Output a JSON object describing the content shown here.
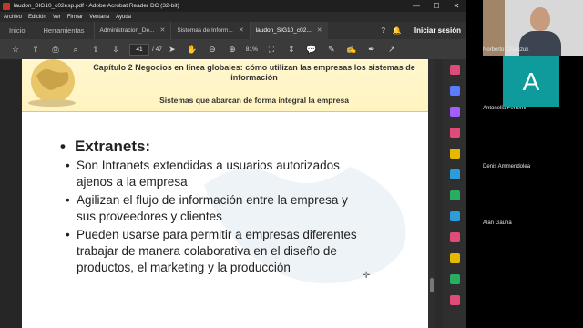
{
  "window": {
    "title": "laudon_SIG10_c02esp.pdf - Adobe Acrobat Reader DC (32-bit)",
    "controls": [
      "—",
      "☐",
      "✕"
    ]
  },
  "menu": [
    "Archivo",
    "Edición",
    "Ver",
    "Firmar",
    "Ventana",
    "Ayuda"
  ],
  "tabs": {
    "home": "Inicio",
    "tools": "Herramientas",
    "documents": [
      {
        "label": "Administracion_De..."
      },
      {
        "label": "Sistemas de Inform..."
      },
      {
        "label": "laudon_SIG10_c02..."
      }
    ],
    "signin": "Iniciar sesión"
  },
  "toolbar": {
    "page_current": "41",
    "page_total": "/ 47",
    "zoom": "81%"
  },
  "slide": {
    "chapter_title": "Capítulo 2 Negocios en línea globales: cómo utilizan las empresas los sistemas de información",
    "section_title": "Sistemas que abarcan de forma integral la empresa",
    "bullet": "Extranets:",
    "items": [
      {
        "line1": "Son Intranets extendidas a usuarios autorizados",
        "line2": "ajenos a la empresa"
      },
      {
        "line1": "Agilizan el flujo de información entre la empresa y",
        "line2": "sus proveedores y clientes"
      },
      {
        "line1": "Pueden usarse para permitir a empresas diferentes",
        "line2": "trabajar de manera colaborativa en el diseño de",
        "line3": "productos, el marketing y la producción"
      }
    ]
  },
  "participants": [
    {
      "name": "Norberto Charczuk"
    },
    {
      "name": "Antonella Ferremi",
      "initial": "A"
    },
    {
      "name": "Denis Ammendolea"
    },
    {
      "name": "Alan Gauna"
    }
  ],
  "colors": {
    "avatar": "#0f9b9b",
    "header_bg": "#fff4c0",
    "rail_icons": [
      "#e14b7a",
      "#5b7cff",
      "#a25cff",
      "#e14b7a",
      "#e6b800",
      "#2d9cdb",
      "#27ae60",
      "#2d9cdb",
      "#e14b7a",
      "#e6b800",
      "#27ae60",
      "#e14b7a"
    ]
  }
}
